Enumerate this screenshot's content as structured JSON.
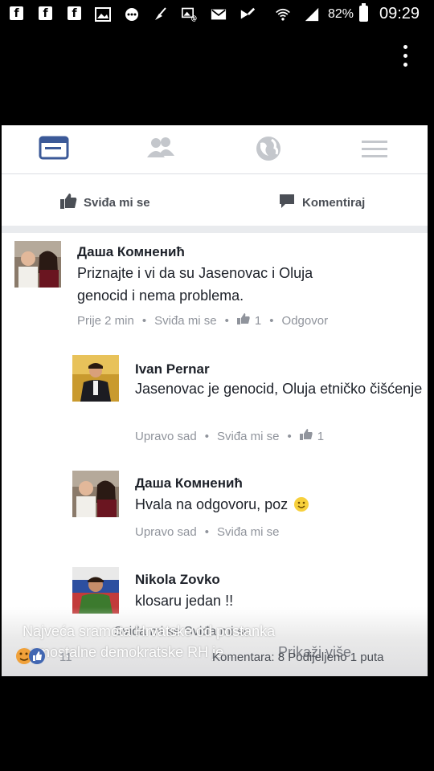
{
  "status_bar": {
    "battery": "82%",
    "time": "09:29",
    "icons": [
      "facebook-icon",
      "facebook-icon",
      "facebook-icon",
      "gallery-icon",
      "messenger-icon",
      "broom-icon",
      "image-sms-icon",
      "gmail-icon",
      "check-icon",
      "wifi-icon",
      "signal-icon",
      "battery-icon"
    ]
  },
  "nav": {
    "icons": [
      "news-feed-icon",
      "friends-icon",
      "globe-icon",
      "menu-icon"
    ],
    "active_color": "#3b5998"
  },
  "actions": {
    "like": "Sviđa mi se",
    "comment": "Komentiraj"
  },
  "comments": [
    {
      "name": "Даша Комненић",
      "text": "Priznajte i vi da su Jasenovac i Oluja genocid i nema problema.",
      "time": "Prije 2 min",
      "like": "Sviđa mi se",
      "like_count": "1",
      "reply": "Odgovor"
    },
    {
      "name": "Ivan Pernar",
      "text": "Jasenovac je genocid, Oluja etničko čišćenje",
      "time": "Upravo sad",
      "like": "Sviđa mi se",
      "like_count": "1"
    },
    {
      "name": "Даша Комненић",
      "text": "Hvala na odgovoru, poz",
      "time": "Upravo sad",
      "like": "Sviđa mi se"
    },
    {
      "name": "Nikola Zovko",
      "text": "klosaru jedan !!"
    }
  ],
  "overlay": {
    "line1": "Najveća sramota Hrvatske od postanka",
    "line2": "samostalne demokratske RH je...",
    "more": "Prikaži više",
    "ghost": "Sviđa mi se   Sviđa mi se",
    "reaction_count": "11",
    "stats": "Komentara: 8  Podijeljeno 1 puta"
  }
}
